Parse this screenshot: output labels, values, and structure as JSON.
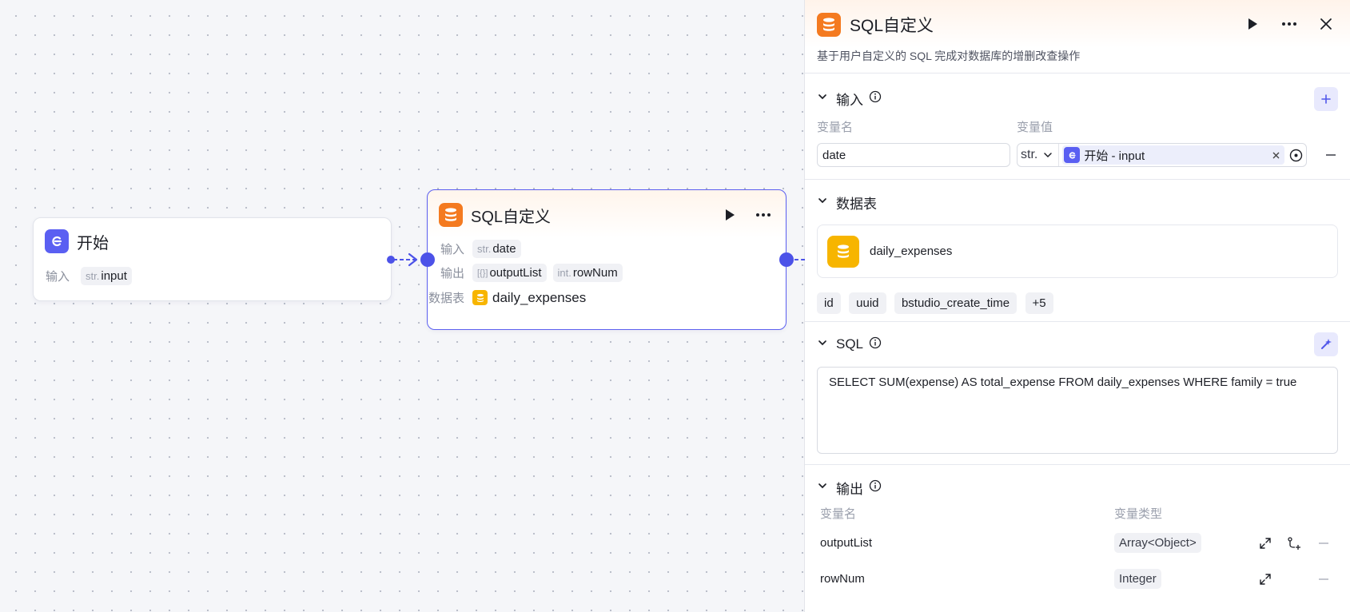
{
  "canvas": {
    "start_node": {
      "title": "开始",
      "input_label": "输入",
      "input_type": "str.",
      "input_name": "input"
    },
    "sql_node": {
      "title": "SQL自定义",
      "input_label": "输入",
      "input_type": "str.",
      "input_name": "date",
      "output_label": "输出",
      "output1_type": "[{}]",
      "output1_name": "outputList",
      "output2_type": "int.",
      "output2_name": "rowNum",
      "table_label": "数据表",
      "table_name": "daily_expenses"
    }
  },
  "panel": {
    "title": "SQL自定义",
    "description": "基于用户自定义的 SQL 完成对数据库的增删改查操作",
    "input_section": {
      "title": "输入",
      "col_name": "变量名",
      "col_value": "变量值",
      "var_name": "date",
      "var_type": "str.",
      "ref_value": "开始 - input"
    },
    "table_section": {
      "title": "数据表",
      "table_name": "daily_expenses",
      "fields": [
        "id",
        "uuid",
        "bstudio_create_time",
        "+5"
      ]
    },
    "sql_section": {
      "title": "SQL",
      "query": "SELECT SUM(expense) AS total_expense FROM daily_expenses WHERE family = true"
    },
    "output_section": {
      "title": "输出",
      "col_name": "变量名",
      "col_type": "变量类型",
      "rows": [
        {
          "name": "outputList",
          "type": "Array<Object>"
        },
        {
          "name": "rowNum",
          "type": "Integer"
        }
      ]
    }
  },
  "colors": {
    "accent": "#4c52e8",
    "sql_icon": "#f47a20",
    "start_icon": "#5a5ff2",
    "db_icon": "#f7b500"
  }
}
